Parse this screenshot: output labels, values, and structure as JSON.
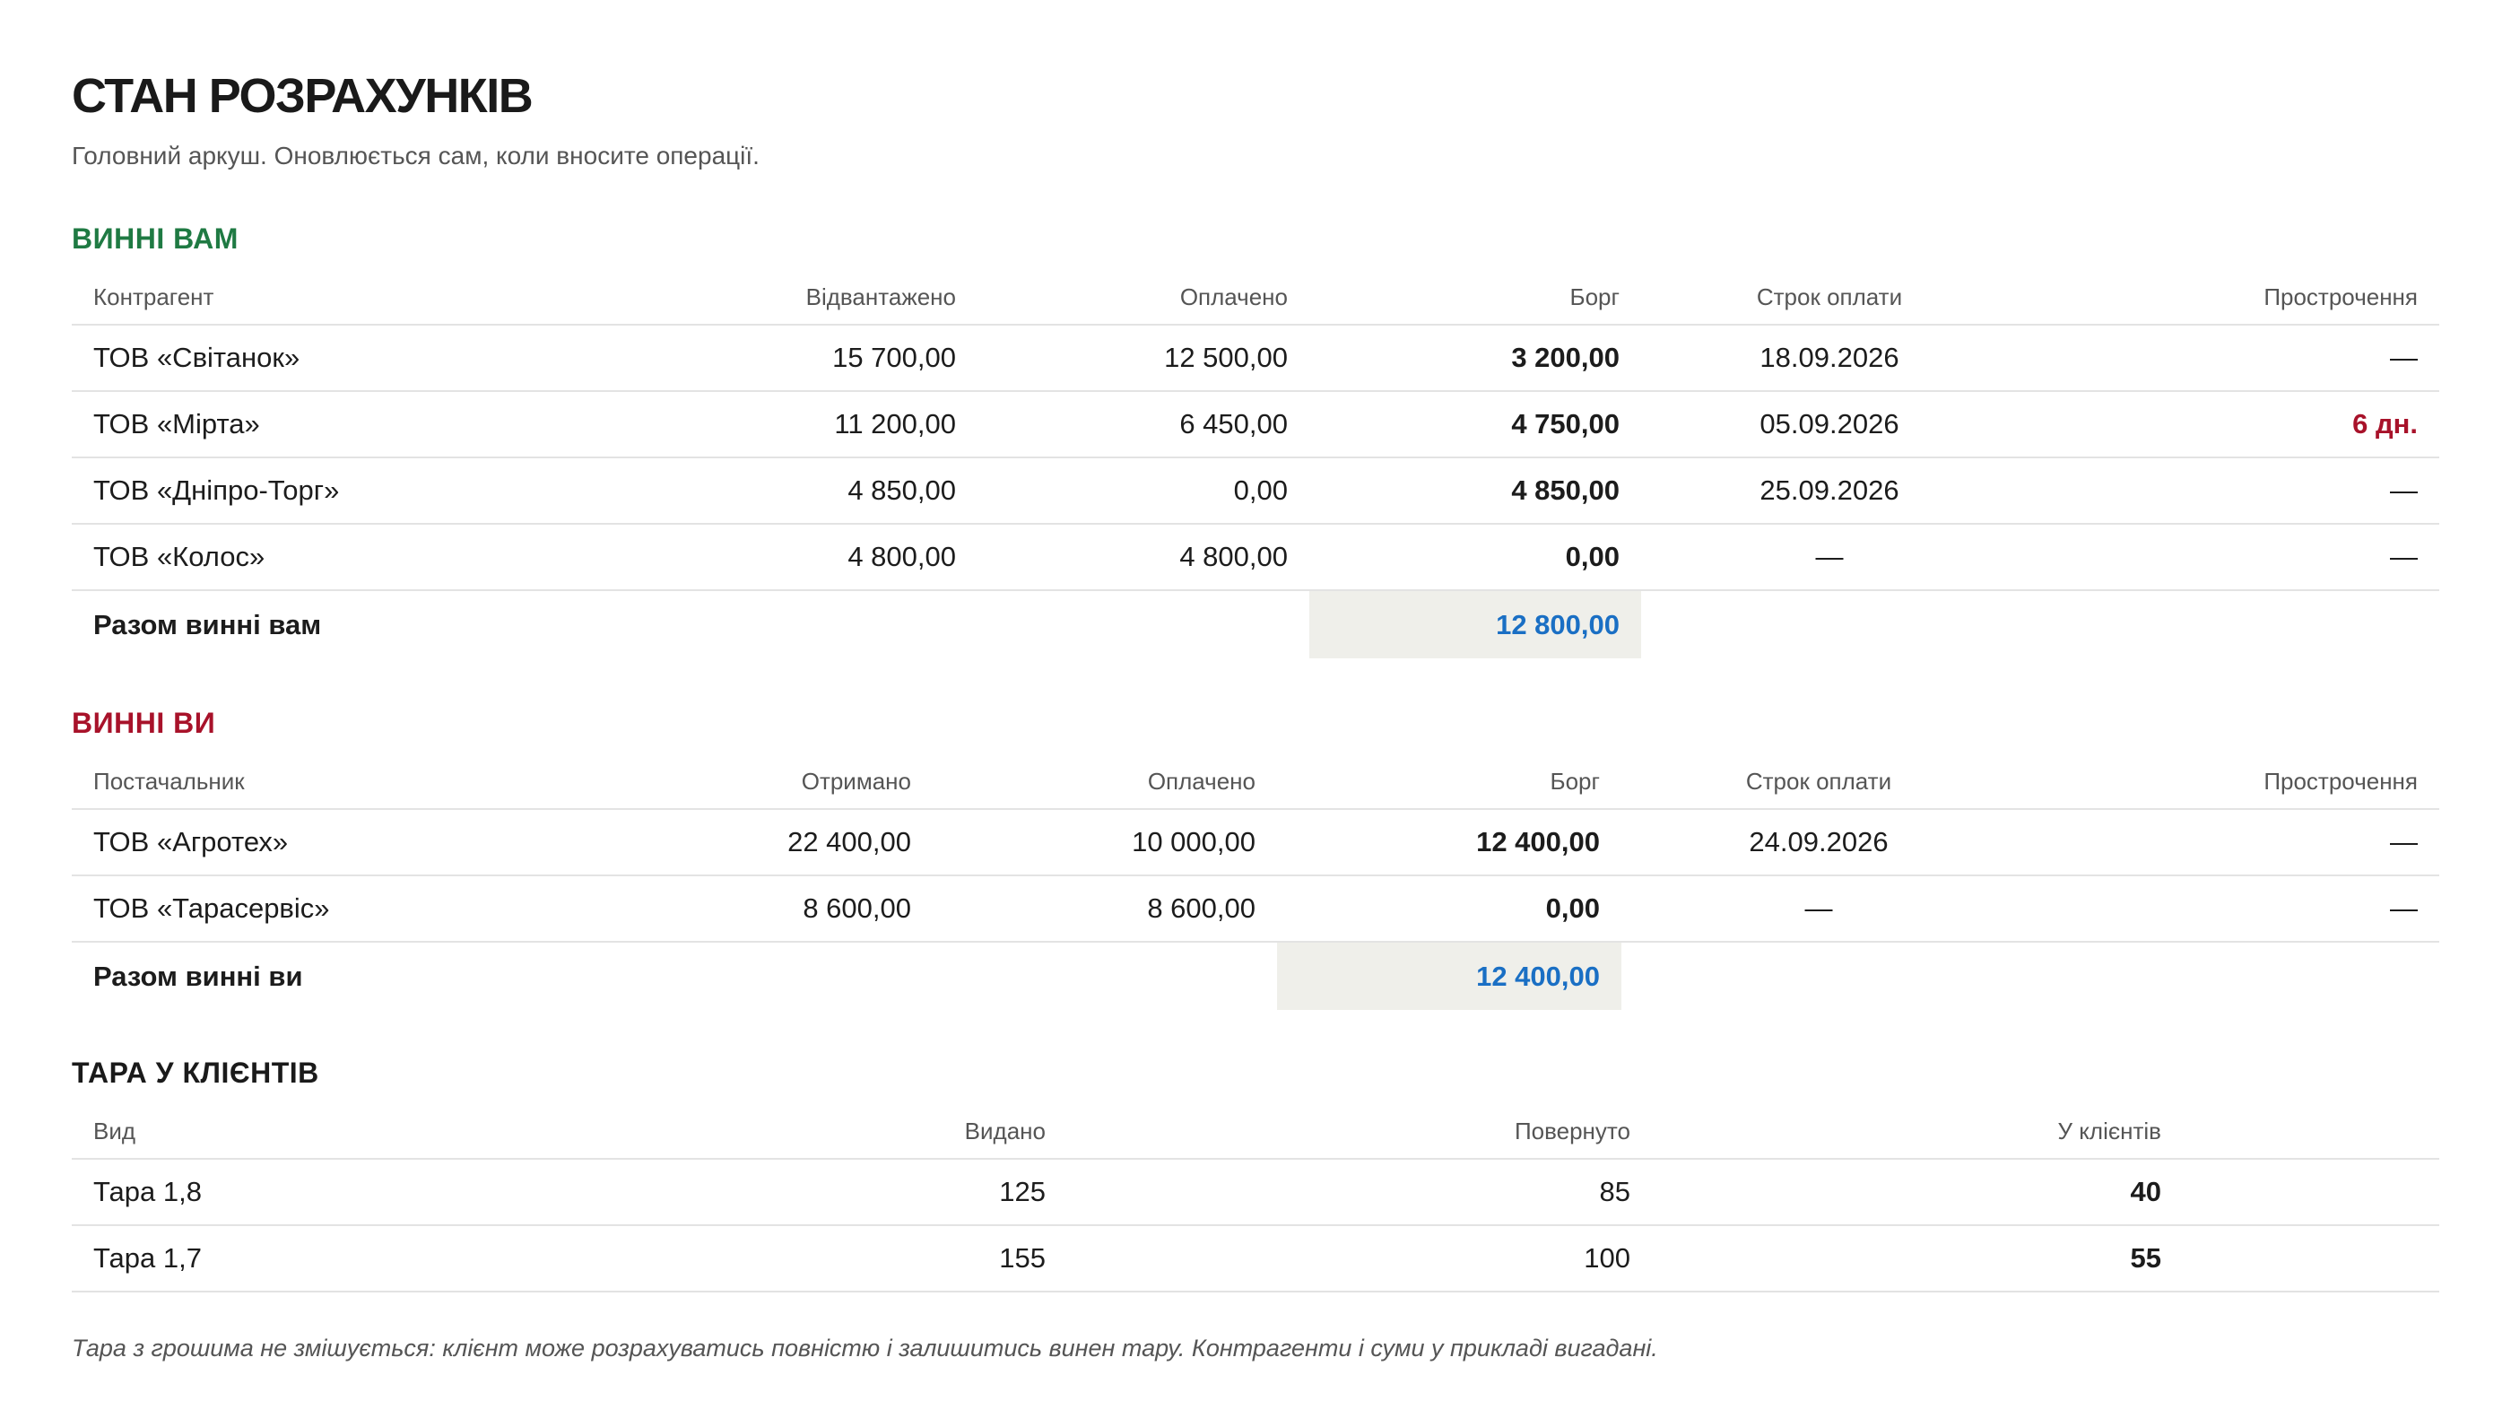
{
  "header": {
    "title": "СТАН РОЗРАХУНКІВ",
    "subtitle": "Головний аркуш. Оновлюється сам, коли вносите операції."
  },
  "receivables": {
    "title": "ВИННІ ВАМ",
    "title_color": "#1f7a43",
    "columns": [
      "Контрагент",
      "Відвантажено",
      "Оплачено",
      "Борг",
      "Строк оплати",
      "Прострочення"
    ],
    "rows": [
      [
        "ТОВ «Світанок»",
        "15 700,00",
        "12 500,00",
        "3 200,00",
        "18.09.2026",
        "—"
      ],
      [
        "ТОВ «Мірта»",
        "11 200,00",
        "6 450,00",
        "4 750,00",
        "05.09.2026",
        "6 дн."
      ],
      [
        "ТОВ «Дніпро-Торг»",
        "4 850,00",
        "0,00",
        "4 850,00",
        "25.09.2026",
        "—"
      ],
      [
        "ТОВ «Колос»",
        "4 800,00",
        "4 800,00",
        "0,00",
        "—",
        "—"
      ]
    ],
    "total_label": "Разом винні вам",
    "total_value": "12 800,00"
  },
  "payables": {
    "title": "ВИННІ ВИ",
    "title_color": "#a8122a",
    "columns": [
      "Постачальник",
      "Отримано",
      "Оплачено",
      "Борг",
      "Строк оплати",
      "Прострочення"
    ],
    "rows": [
      [
        "ТОВ «Агротех»",
        "22 400,00",
        "10 000,00",
        "12 400,00",
        "24.09.2026",
        "—"
      ],
      [
        "ТОВ «Тарасервіс»",
        "8 600,00",
        "8 600,00",
        "0,00",
        "—",
        "—"
      ]
    ],
    "total_label": "Разом винні ви",
    "total_value": "12 400,00"
  },
  "containers": {
    "title": "ТАРА У КЛІЄНТІВ",
    "title_color": "#1a1a1a",
    "columns": [
      "Вид",
      "Видано",
      "Повернуто",
      "У клієнтів"
    ],
    "rows": [
      [
        "Тара 1,8",
        "125",
        "85",
        "40"
      ],
      [
        "Тара 1,7",
        "155",
        "100",
        "55"
      ]
    ]
  },
  "footnote": "Тара з грошима не змішується: клієнт може розрахуватись повністю і залишитись винен тару. Контрагенти і суми у прикладі вигадані.",
  "colors": {
    "total_value": "#1a6fc4",
    "total_bg": "#efefea",
    "overdue": "#a8122a"
  }
}
